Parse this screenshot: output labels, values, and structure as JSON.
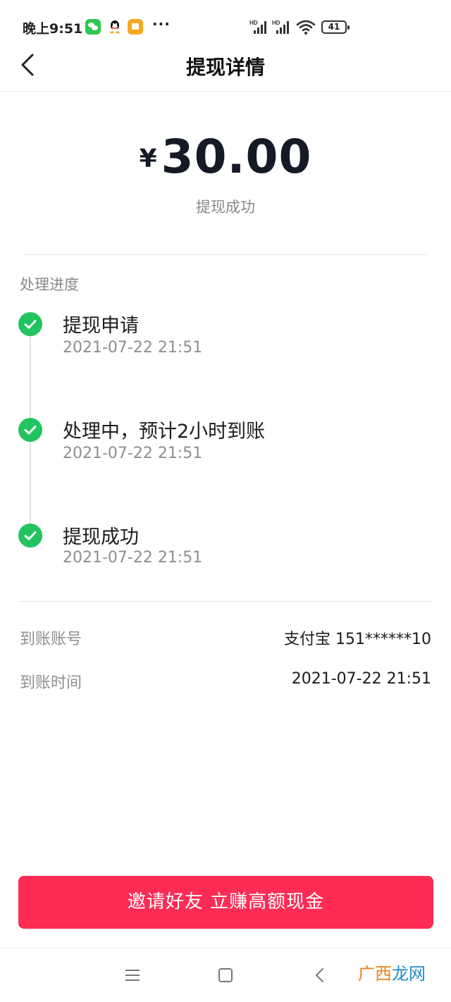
{
  "status_bar": {
    "time": "晚上9:51",
    "dots": "···",
    "battery": "41",
    "icons": [
      "wechat-icon",
      "qq-icon",
      "notes-app-icon",
      "hd-signal-icon",
      "hd-signal-icon",
      "wifi-icon",
      "battery-icon"
    ]
  },
  "header": {
    "title": "提现详情",
    "back_icon": "chevron-left-icon"
  },
  "amount": {
    "currency": "¥",
    "value": "30.00",
    "status": "提现成功"
  },
  "progress": {
    "title": "处理进度",
    "steps": [
      {
        "title": "提现申请",
        "time": "2021-07-22 21:51",
        "status": "done"
      },
      {
        "title": "处理中，预计2小时到账",
        "time": "2021-07-22 21:51",
        "status": "done"
      },
      {
        "title": "提现成功",
        "time": "2021-07-22 21:51",
        "status": "done"
      }
    ],
    "step_icon": "check-circle-icon",
    "done_color": "#21c45e"
  },
  "details": {
    "account_label": "到账账号",
    "account_value": "支付宝 151******10",
    "time_label": "到账时间",
    "time_value": "2021-07-22 21:51"
  },
  "cta": {
    "label": "邀请好友 立赚高额现金",
    "color": "#fe2c55"
  },
  "system_nav": {
    "icons": [
      "menu-icon",
      "home-icon",
      "back-icon"
    ]
  },
  "watermark": {
    "part1": "广西",
    "part2": "龙网"
  }
}
